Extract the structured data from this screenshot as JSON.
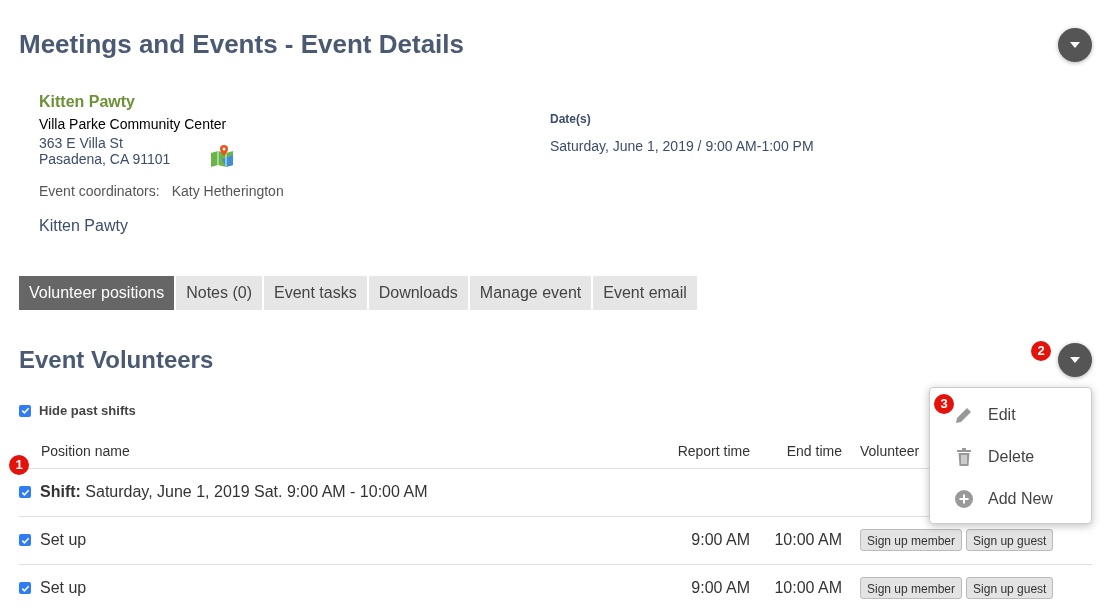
{
  "page": {
    "title": "Meetings and Events - Event Details"
  },
  "event": {
    "name": "Kitten Pawty",
    "venue": "Villa Parke Community Center",
    "address_lines": [
      "363 E Villa St",
      "Pasadena, CA 91101"
    ],
    "coordinators_label": "Event coordinators:",
    "coordinators": "Katy Hetherington",
    "description": "Kitten Pawty",
    "dates_label": "Date(s)",
    "dates": "Saturday, June 1, 2019 / 9:00 AM-1:00 PM"
  },
  "tabs": [
    {
      "label": "Volunteer positions",
      "selected": true
    },
    {
      "label": "Notes (0)",
      "selected": false
    },
    {
      "label": "Event tasks",
      "selected": false
    },
    {
      "label": "Downloads",
      "selected": false
    },
    {
      "label": "Manage event",
      "selected": false
    },
    {
      "label": "Event email",
      "selected": false
    }
  ],
  "section": {
    "title": "Event Volunteers",
    "hide_past": {
      "label": "Hide past shifts",
      "checked": true
    }
  },
  "table": {
    "columns": [
      "Position name",
      "Report time",
      "End time",
      "Volunteer"
    ],
    "rows": [
      {
        "kind": "shift",
        "checked": true,
        "prefix": "Shift:",
        "label": "Saturday, June 1, 2019 Sat. 9:00 AM - 10:00 AM"
      },
      {
        "kind": "position",
        "checked": true,
        "label": "Set up",
        "report": "9:00 AM",
        "end": "10:00 AM",
        "buttons": [
          {
            "label": "Sign up member"
          },
          {
            "label": "Sign up guest"
          }
        ]
      },
      {
        "kind": "position",
        "checked": true,
        "label": "Set up",
        "report": "9:00 AM",
        "end": "10:00 AM",
        "buttons": [
          {
            "label": "Sign up member"
          },
          {
            "label": "Sign up guest"
          }
        ]
      }
    ]
  },
  "menu": {
    "items": [
      {
        "kind": "edit",
        "label": "Edit"
      },
      {
        "kind": "delete",
        "label": "Delete"
      },
      {
        "kind": "add",
        "label": "Add New"
      }
    ]
  },
  "markers": [
    "1",
    "2",
    "3"
  ]
}
